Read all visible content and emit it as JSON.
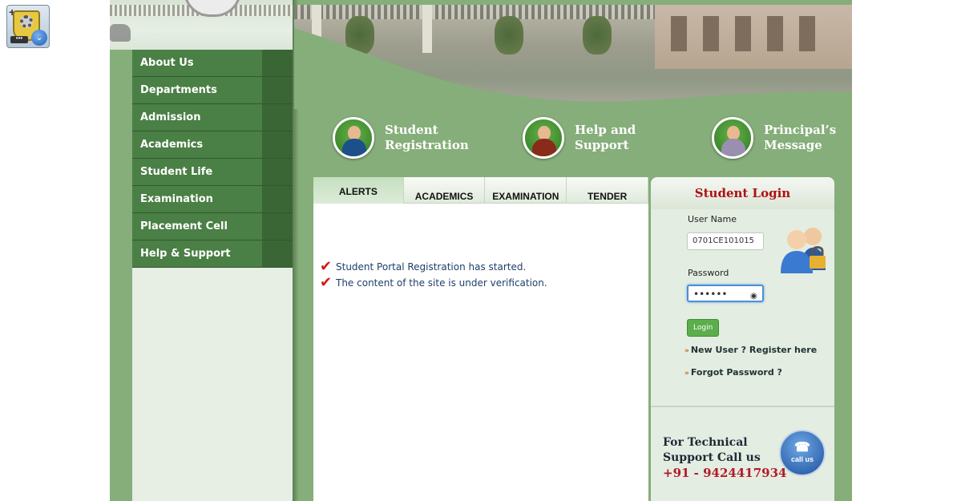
{
  "nav": {
    "items": [
      {
        "label": "About Us"
      },
      {
        "label": "Departments"
      },
      {
        "label": "Admission"
      },
      {
        "label": "Academics"
      },
      {
        "label": "Student Life"
      },
      {
        "label": "Examination"
      },
      {
        "label": "Placement Cell"
      },
      {
        "label": "Help & Support"
      }
    ]
  },
  "quick_links": [
    {
      "line1": "Student",
      "line2": "Registration",
      "icon": "graduate-student-icon"
    },
    {
      "line1": "Help and",
      "line2": "Support",
      "icon": "support-agent-icon"
    },
    {
      "line1": "Principal’s",
      "line2": "Message",
      "icon": "principal-icon"
    }
  ],
  "tabs": [
    {
      "label": "ALERTS",
      "active": true
    },
    {
      "label": "ACADEMICS"
    },
    {
      "label": "EXAMINATION"
    },
    {
      "label": "TENDER"
    }
  ],
  "alerts": [
    "Student Portal Registration has started.",
    "The content of the site is under verification."
  ],
  "login": {
    "title": "Student Login",
    "username_label": "User Name",
    "username_value": "0701CE101015",
    "password_label": "Password",
    "password_value": "••••••",
    "button": "Login",
    "new_user": "New User ? Register here",
    "forgot": "Forgot Password ?"
  },
  "support": {
    "line1": "For Technical",
    "line2": "Support Call us",
    "phone": "+91 - 9424417934",
    "badge": "call us"
  },
  "colors": {
    "nav_bg": "#4a7f45",
    "page_green": "#86ae7a",
    "login_title": "#b01010",
    "phone": "#b31a2a"
  }
}
